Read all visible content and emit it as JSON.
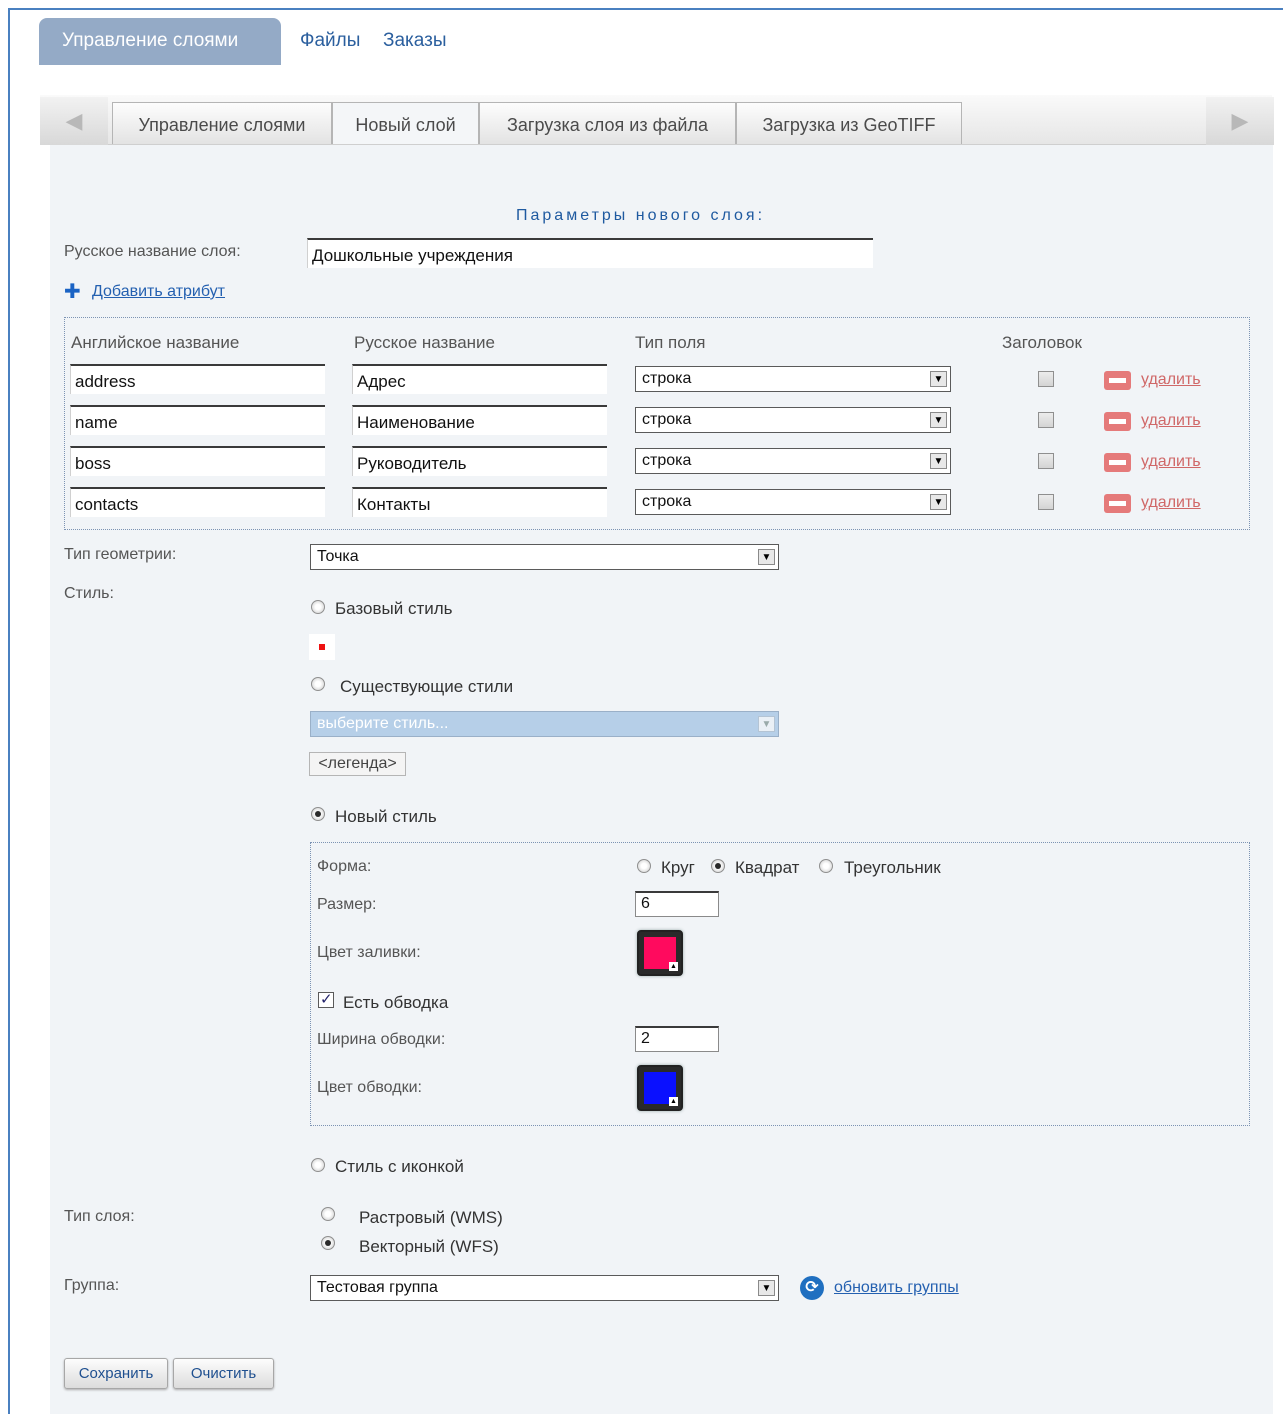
{
  "top_nav": {
    "active": "Управление слоями",
    "links": [
      "Файлы",
      "Заказы"
    ]
  },
  "tabs": {
    "prev_icon": "◀",
    "next_icon": "▶",
    "items": [
      "Управление слоями",
      "Новый слой",
      "Загрузка слоя из файла",
      "Загрузка из GeoTIFF"
    ],
    "active": "Новый слой"
  },
  "form": {
    "section_title": "Параметры нового слоя:",
    "layer_name_label": "Русское название слоя:",
    "layer_name_value": "Дошкольные учреждения",
    "add_attribute": "Добавить атрибут",
    "attributes": {
      "headers": [
        "Английское название",
        "Русское название",
        "Тип поля",
        "Заголовок"
      ],
      "rows": [
        {
          "en": "address",
          "ru": "Адрес",
          "type": "строка",
          "title": false,
          "delete": "удалить"
        },
        {
          "en": "name",
          "ru": "Наименование",
          "type": "строка",
          "title": false,
          "delete": "удалить"
        },
        {
          "en": "boss",
          "ru": "Руководитель",
          "type": "строка",
          "title": false,
          "delete": "удалить"
        },
        {
          "en": "contacts",
          "ru": "Контакты",
          "type": "строка",
          "title": false,
          "delete": "удалить"
        }
      ]
    },
    "geometry_label": "Тип геометрии:",
    "geometry_value": "Точка",
    "style_label": "Стиль:",
    "style_options": {
      "base": "Базовый стиль",
      "existing": "Существующие стили",
      "existing_placeholder": "выберите стиль...",
      "legend_button": "<легенда>",
      "new": "Новый стиль",
      "icon": "Стиль с иконкой",
      "selected": "new"
    },
    "new_style": {
      "shape_label": "Форма:",
      "shapes": [
        "Круг",
        "Квадрат",
        "Треугольник"
      ],
      "shape_selected": "Квадрат",
      "size_label": "Размер:",
      "size_value": "6",
      "fill_label": "Цвет заливки:",
      "fill_color": "#ff0a5e",
      "has_stroke_label": "Есть обводка",
      "has_stroke": true,
      "stroke_width_label": "Ширина обводки:",
      "stroke_width_value": "2",
      "stroke_color_label": "Цвет обводки:",
      "stroke_color": "#0a10ff"
    },
    "layer_type_label": "Тип слоя:",
    "layer_types": [
      "Растровый (WMS)",
      "Векторный (WFS)"
    ],
    "layer_type_selected": "Векторный (WFS)",
    "group_label": "Группа:",
    "group_value": "Тестовая группа",
    "refresh_groups": "обновить группы",
    "save_button": "Сохранить",
    "clear_button": "Очистить"
  },
  "colors": {
    "accent": "#2460b0",
    "tab_active_bg": "#94aac6",
    "panel_bg": "#f1f4f7",
    "delete": "#e57a7a"
  }
}
